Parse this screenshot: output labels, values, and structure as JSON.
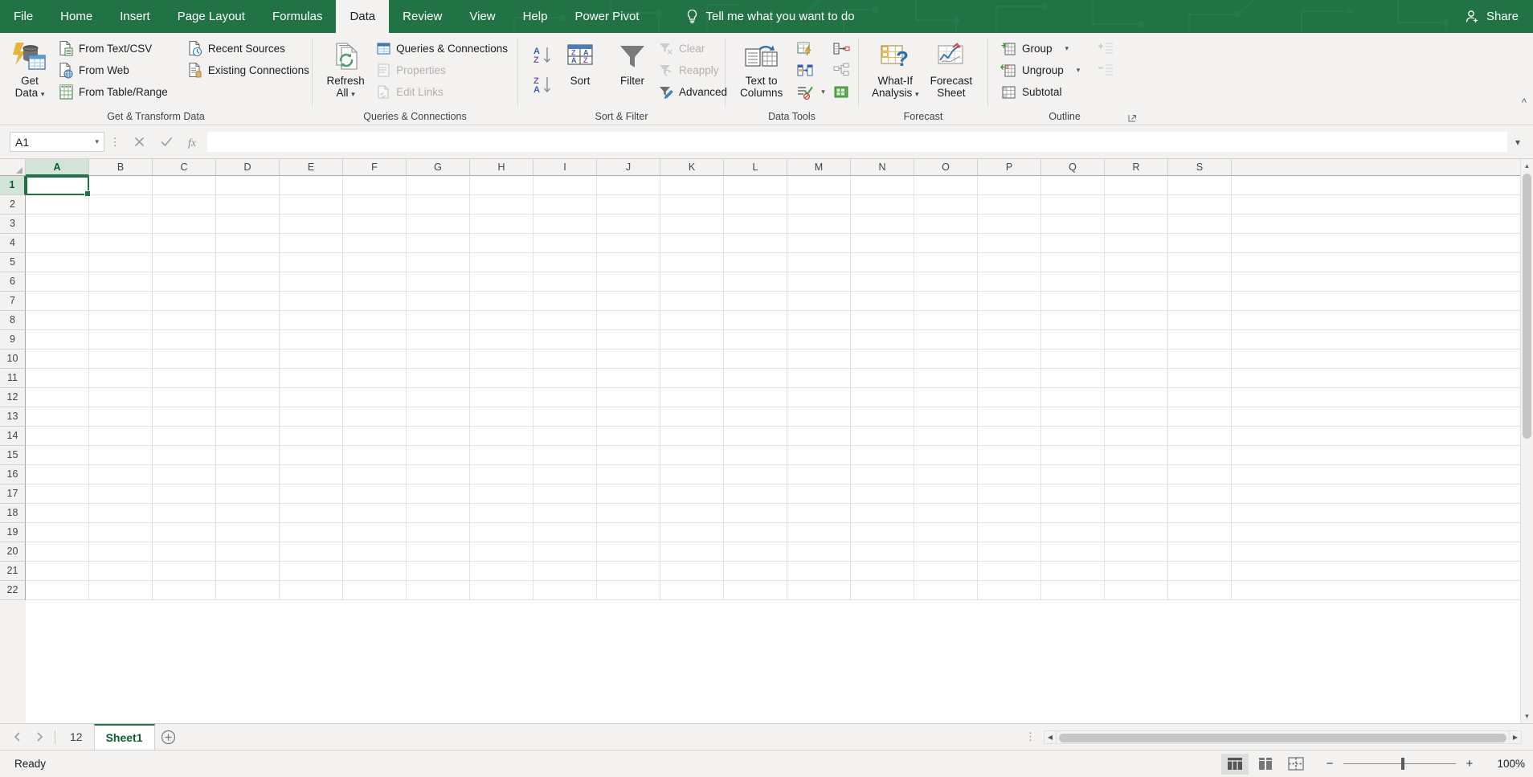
{
  "titlebar": {
    "tabs": [
      {
        "label": "File",
        "active": false
      },
      {
        "label": "Home",
        "active": false
      },
      {
        "label": "Insert",
        "active": false
      },
      {
        "label": "Page Layout",
        "active": false
      },
      {
        "label": "Formulas",
        "active": false
      },
      {
        "label": "Data",
        "active": true
      },
      {
        "label": "Review",
        "active": false
      },
      {
        "label": "View",
        "active": false
      },
      {
        "label": "Help",
        "active": false
      },
      {
        "label": "Power Pivot",
        "active": false
      }
    ],
    "tellme": "Tell me what you want to do",
    "share": "Share",
    "accent": "#217346"
  },
  "ribbon": {
    "groups": [
      {
        "name": "Get & Transform Data",
        "big": [
          {
            "label_line1": "Get",
            "label_line2": "Data",
            "caret": true
          }
        ],
        "small": [
          {
            "label": "From Text/CSV",
            "disabled": false
          },
          {
            "label": "From Web",
            "disabled": false
          },
          {
            "label": "From Table/Range",
            "disabled": false
          },
          {
            "label": "Recent Sources",
            "disabled": false
          },
          {
            "label": "Existing Connections",
            "disabled": false
          }
        ]
      },
      {
        "name": "Queries & Connections",
        "big": [
          {
            "label_line1": "Refresh",
            "label_line2": "All",
            "caret": true
          }
        ],
        "small": [
          {
            "label": "Queries & Connections",
            "disabled": false
          },
          {
            "label": "Properties",
            "disabled": true
          },
          {
            "label": "Edit Links",
            "disabled": true
          }
        ]
      },
      {
        "name": "Sort & Filter",
        "big": [
          {
            "label_line1": "Sort",
            "label_line2": "",
            "caret": false
          },
          {
            "label_line1": "Filter",
            "label_line2": "",
            "caret": false
          }
        ],
        "small": [
          {
            "label": "Clear",
            "disabled": true
          },
          {
            "label": "Reapply",
            "disabled": true
          },
          {
            "label": "Advanced",
            "disabled": false
          }
        ],
        "icon_only": [
          "sort-ascending",
          "sort-descending"
        ]
      },
      {
        "name": "Data Tools",
        "big": [
          {
            "label_line1": "Text to",
            "label_line2": "Columns",
            "caret": false
          }
        ],
        "icon_only": [
          "flash-fill",
          "remove-duplicates",
          "data-validation",
          "consolidate",
          "relationships",
          "manage-data-model"
        ]
      },
      {
        "name": "Forecast",
        "big": [
          {
            "label_line1": "What-If",
            "label_line2": "Analysis",
            "caret": true
          },
          {
            "label_line1": "Forecast",
            "label_line2": "Sheet",
            "caret": false
          }
        ]
      },
      {
        "name": "Outline",
        "small": [
          {
            "label": "Group",
            "disabled": false,
            "caret": true
          },
          {
            "label": "Ungroup",
            "disabled": false,
            "caret": true
          },
          {
            "label": "Subtotal",
            "disabled": false,
            "caret": false
          }
        ],
        "icon_only": [
          "show-detail",
          "hide-detail"
        ]
      }
    ]
  },
  "formulabar": {
    "namebox_value": "A1",
    "formula_value": "",
    "cancel_icon": "close-icon",
    "enter_icon": "check-icon",
    "function_icon": "fx-icon"
  },
  "grid": {
    "columns": [
      "A",
      "B",
      "C",
      "D",
      "E",
      "F",
      "G",
      "H",
      "I",
      "J",
      "K",
      "L",
      "M",
      "N",
      "O",
      "P",
      "Q",
      "R",
      "S"
    ],
    "rows": [
      "1",
      "2",
      "3",
      "4",
      "5",
      "6",
      "7",
      "8",
      "9",
      "10",
      "11",
      "12",
      "13",
      "14",
      "15",
      "16",
      "17",
      "18",
      "19",
      "20",
      "21",
      "22"
    ],
    "selected_column": "A",
    "selected_row": "1",
    "active_cell": "A1"
  },
  "sheettabs": {
    "tabs": [
      {
        "label": "12",
        "active": false
      },
      {
        "label": "Sheet1",
        "active": true
      }
    ],
    "add_label": "+"
  },
  "statusbar": {
    "status": "Ready",
    "zoom": "100%",
    "views": [
      "normal-view",
      "page-layout-view",
      "page-break-view"
    ],
    "active_view": "normal-view"
  }
}
